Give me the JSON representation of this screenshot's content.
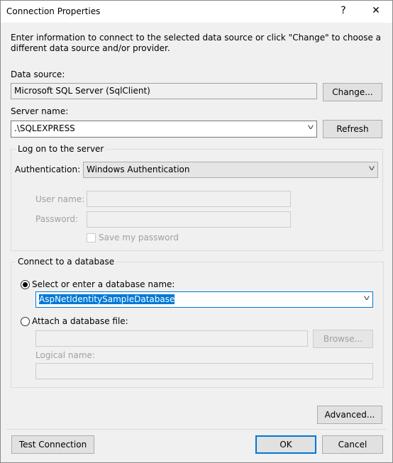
{
  "window": {
    "title": "Connection Properties",
    "help": "?",
    "close": "✕"
  },
  "instructions": "Enter information to connect to the selected data source or click \"Change\" to choose a different data source and/or provider.",
  "data_source": {
    "label": "Data source:",
    "value": "Microsoft SQL Server (SqlClient)",
    "change_button": "Change..."
  },
  "server": {
    "label": "Server name:",
    "value": ".\\SQLEXPRESS",
    "refresh_button": "Refresh"
  },
  "logon": {
    "legend": "Log on to the server",
    "auth_label": "Authentication:",
    "auth_value": "Windows Authentication",
    "user_label": "User name:",
    "user_value": "",
    "password_label": "Password:",
    "password_value": "",
    "save_password": "Save my password",
    "save_password_checked": false
  },
  "database": {
    "legend": "Connect to a database",
    "select_radio": "Select or enter a database name:",
    "select_checked": true,
    "db_name": "AspNetIdentitySampleDatabase",
    "attach_radio": "Attach a database file:",
    "attach_checked": false,
    "file_value": "",
    "browse_button": "Browse...",
    "logical_label": "Logical name:",
    "logical_value": ""
  },
  "buttons": {
    "advanced": "Advanced...",
    "test": "Test Connection",
    "ok": "OK",
    "cancel": "Cancel"
  },
  "colors": {
    "accent": "#0078d7",
    "background": "#f0f0f0"
  }
}
